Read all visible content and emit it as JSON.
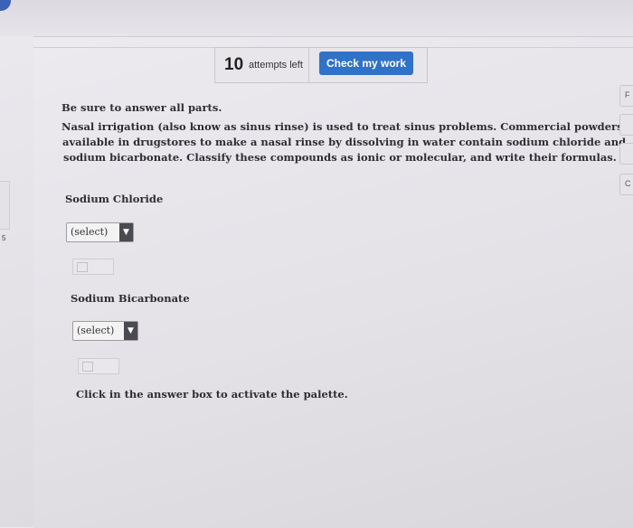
{
  "header": {
    "attempts_count": "10",
    "attempts_label": "attempts left",
    "check_button_label": "Check my work"
  },
  "question": {
    "instruction": "Be sure to answer all parts.",
    "prompt_lines": [
      "Nasal irrigation (also know as sinus rinse) is used to treat sinus problems. Commercial powders",
      "available in drugstores to make a nasal rinse by dissolving in water contain sodium chloride and",
      "sodium bicarbonate. Classify these compounds as ionic or molecular, and write their formulas."
    ],
    "parts": [
      {
        "label": "Sodium Chloride",
        "select_value": "(select)"
      },
      {
        "label": "Sodium Bicarbonate",
        "select_value": "(select)"
      }
    ],
    "footer_hint": "Click in the answer box to activate the palette."
  },
  "side": {
    "left_number": "5",
    "right_letters": [
      "F",
      "C"
    ]
  },
  "colors": {
    "accent": "#2f72c8",
    "background": "#e6e4e9"
  },
  "icons": {
    "select_arrow": "caret-down-icon"
  }
}
